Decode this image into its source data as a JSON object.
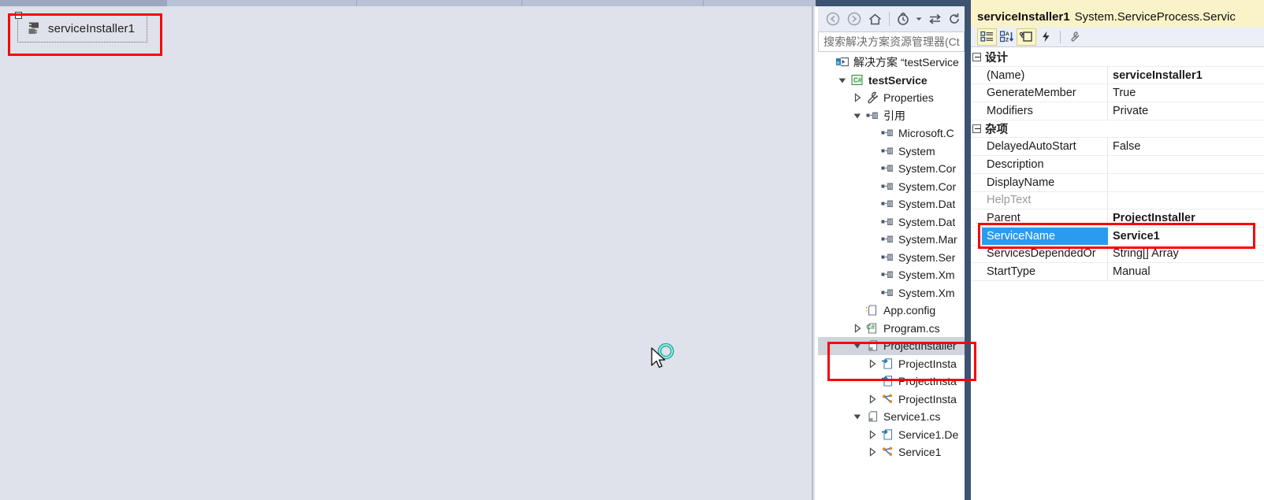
{
  "designer": {
    "component_label": "serviceInstaller1",
    "component_icon": "component-tray-icon",
    "selection_handle": "selection-handle",
    "cursor": "busy-arrow-cursor"
  },
  "solution_explorer": {
    "toolbar": [
      {
        "name": "back-icon",
        "glyph": "↺"
      },
      {
        "name": "forward-icon",
        "glyph": "↻"
      },
      {
        "name": "home-icon",
        "glyph": "⌂"
      },
      {
        "name": "pending-changes-icon",
        "glyph": "◔"
      },
      {
        "name": "chevron-down-icon",
        "glyph": "▾"
      },
      {
        "name": "sync-icon",
        "glyph": "⇄"
      },
      {
        "name": "refresh-icon",
        "glyph": "⟳"
      }
    ],
    "search_placeholder": "搜索解决方案资源管理器(Ct",
    "tree": [
      {
        "label": "解决方案 “testService",
        "indent": 0,
        "arrow": "none",
        "icon": "solution-icon",
        "bold": false,
        "selected": false
      },
      {
        "label": "testService",
        "indent": 1,
        "arrow": "expanded",
        "icon": "csharp-project-icon",
        "bold": true,
        "selected": false
      },
      {
        "label": "Properties",
        "indent": 2,
        "arrow": "collapsed",
        "icon": "wrench-icon",
        "bold": false,
        "selected": false
      },
      {
        "label": "引用",
        "indent": 2,
        "arrow": "expanded",
        "icon": "references-icon",
        "bold": false,
        "selected": false
      },
      {
        "label": "Microsoft.C",
        "indent": 3,
        "arrow": "none",
        "icon": "reference-icon",
        "bold": false,
        "selected": false
      },
      {
        "label": "System",
        "indent": 3,
        "arrow": "none",
        "icon": "reference-icon",
        "bold": false,
        "selected": false
      },
      {
        "label": "System.Cor",
        "indent": 3,
        "arrow": "none",
        "icon": "reference-icon",
        "bold": false,
        "selected": false
      },
      {
        "label": "System.Cor",
        "indent": 3,
        "arrow": "none",
        "icon": "reference-icon",
        "bold": false,
        "selected": false
      },
      {
        "label": "System.Dat",
        "indent": 3,
        "arrow": "none",
        "icon": "reference-icon",
        "bold": false,
        "selected": false
      },
      {
        "label": "System.Dat",
        "indent": 3,
        "arrow": "none",
        "icon": "reference-icon",
        "bold": false,
        "selected": false
      },
      {
        "label": "System.Mar",
        "indent": 3,
        "arrow": "none",
        "icon": "reference-icon",
        "bold": false,
        "selected": false
      },
      {
        "label": "System.Ser",
        "indent": 3,
        "arrow": "none",
        "icon": "reference-icon",
        "bold": false,
        "selected": false
      },
      {
        "label": "System.Xm",
        "indent": 3,
        "arrow": "none",
        "icon": "reference-icon",
        "bold": false,
        "selected": false
      },
      {
        "label": "System.Xm",
        "indent": 3,
        "arrow": "none",
        "icon": "reference-icon",
        "bold": false,
        "selected": false
      },
      {
        "label": "App.config",
        "indent": 2,
        "arrow": "none",
        "icon": "config-file-icon",
        "bold": false,
        "selected": false
      },
      {
        "label": "Program.cs",
        "indent": 2,
        "arrow": "collapsed",
        "icon": "csharp-file-icon",
        "bold": false,
        "selected": false
      },
      {
        "label": "ProjectInstaller",
        "indent": 2,
        "arrow": "expanded",
        "icon": "designer-file-icon",
        "bold": false,
        "selected": true
      },
      {
        "label": "ProjectInsta",
        "indent": 3,
        "arrow": "collapsed",
        "icon": "designer-cs-icon",
        "bold": false,
        "selected": false
      },
      {
        "label": "ProjectInsta",
        "indent": 3,
        "arrow": "none",
        "icon": "designer-cs-icon",
        "bold": false,
        "selected": false
      },
      {
        "label": "ProjectInsta",
        "indent": 3,
        "arrow": "collapsed",
        "icon": "resx-icon",
        "bold": false,
        "selected": false
      },
      {
        "label": "Service1.cs",
        "indent": 2,
        "arrow": "expanded",
        "icon": "designer-file-icon",
        "bold": false,
        "selected": false
      },
      {
        "label": "Service1.De",
        "indent": 3,
        "arrow": "collapsed",
        "icon": "designer-cs-icon",
        "bold": false,
        "selected": false
      },
      {
        "label": "Service1",
        "indent": 3,
        "arrow": "collapsed",
        "icon": "resx-icon",
        "bold": false,
        "selected": false
      }
    ]
  },
  "properties": {
    "header_object": "serviceInstaller1",
    "header_type": "System.ServiceProcess.Servic",
    "toolbar": [
      {
        "name": "categorized-view-button",
        "active": true
      },
      {
        "name": "alphabetical-sort-button",
        "active": false
      },
      {
        "name": "properties-button",
        "active": true
      },
      {
        "name": "events-button",
        "active": false
      },
      {
        "name": "property-pages-button",
        "active": false
      }
    ],
    "rows": [
      {
        "type": "category",
        "name": "设计"
      },
      {
        "type": "prop",
        "name": "(Name)",
        "value": "serviceInstaller1",
        "bold_value": true,
        "dim": false,
        "selected": false
      },
      {
        "type": "prop",
        "name": "GenerateMember",
        "value": "True",
        "bold_value": false,
        "dim": false,
        "selected": false
      },
      {
        "type": "prop",
        "name": "Modifiers",
        "value": "Private",
        "bold_value": false,
        "dim": false,
        "selected": false
      },
      {
        "type": "category",
        "name": "杂项"
      },
      {
        "type": "prop",
        "name": "DelayedAutoStart",
        "value": "False",
        "bold_value": false,
        "dim": false,
        "selected": false
      },
      {
        "type": "prop",
        "name": "Description",
        "value": "",
        "bold_value": false,
        "dim": false,
        "selected": false
      },
      {
        "type": "prop",
        "name": "DisplayName",
        "value": "",
        "bold_value": false,
        "dim": false,
        "selected": false
      },
      {
        "type": "prop",
        "name": "HelpText",
        "value": "",
        "bold_value": false,
        "dim": true,
        "selected": false
      },
      {
        "type": "prop",
        "name": "Parent",
        "value": "ProjectInstaller",
        "bold_value": true,
        "dim": false,
        "selected": false
      },
      {
        "type": "prop",
        "name": "ServiceName",
        "value": "Service1",
        "bold_value": true,
        "dim": false,
        "selected": true
      },
      {
        "type": "prop",
        "name": "ServicesDependedOr",
        "value": "String[] Array",
        "bold_value": false,
        "dim": false,
        "selected": false
      },
      {
        "type": "prop",
        "name": "StartType",
        "value": "Manual",
        "bold_value": false,
        "dim": false,
        "selected": false
      }
    ]
  },
  "annotations": {
    "accent_red": "#fb0007",
    "selection_blue": "#2b9bf0",
    "header_yellow": "#faf3c8"
  }
}
